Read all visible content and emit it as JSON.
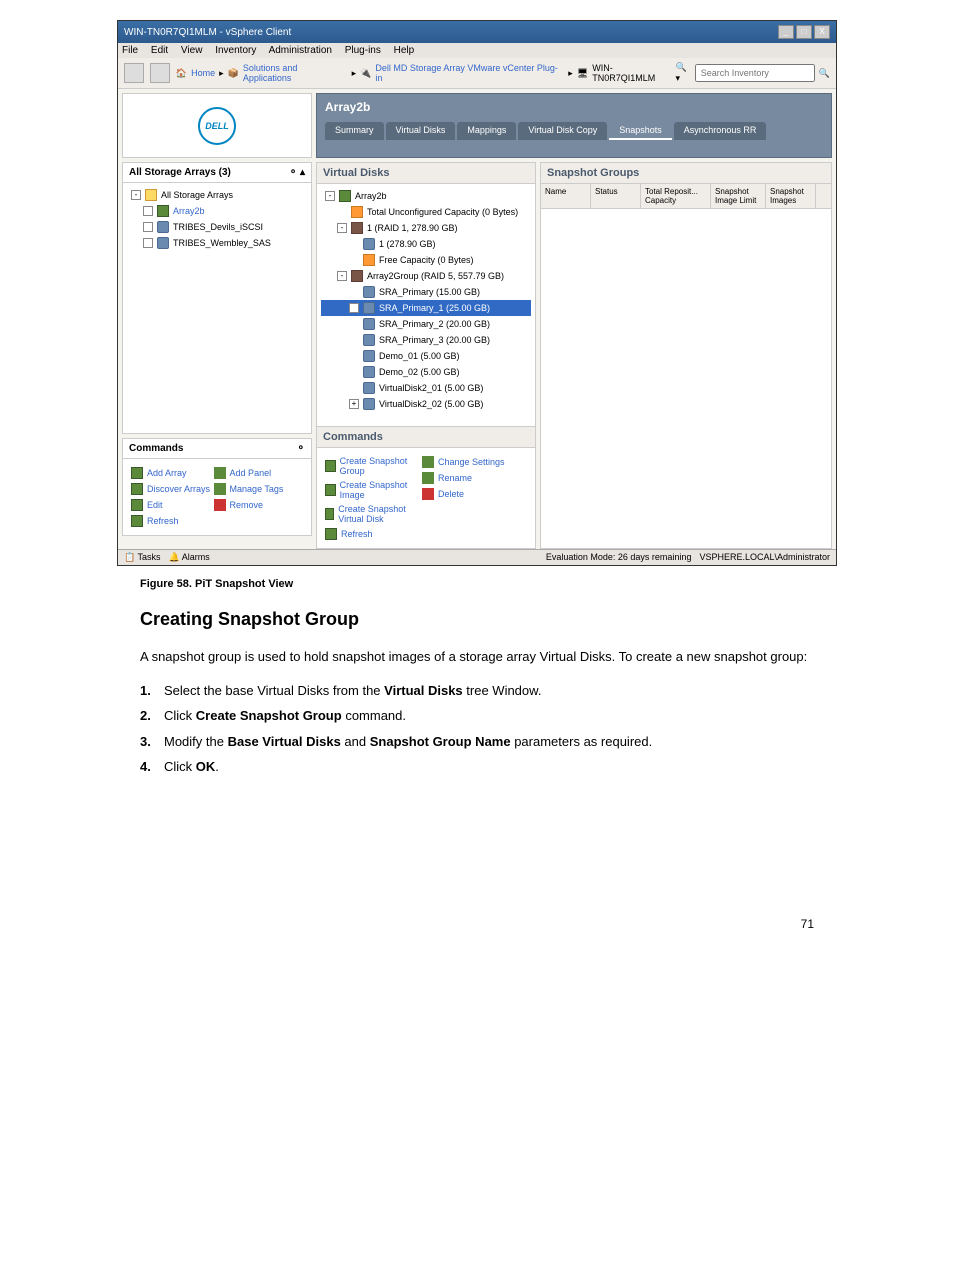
{
  "window": {
    "title": "WIN-TN0R7QI1MLM - vSphere Client",
    "menubar": [
      "File",
      "Edit",
      "View",
      "Inventory",
      "Administration",
      "Plug-ins",
      "Help"
    ]
  },
  "toolbar": {
    "breadcrumb": [
      "Home",
      "Solutions and Applications",
      "Dell MD Storage Array VMware vCenter Plug-in",
      "WIN-TN0R7QI1MLM"
    ],
    "search_placeholder": "Search Inventory"
  },
  "header": {
    "dell": "DELL",
    "title": "Array2b",
    "tabs": [
      "Summary",
      "Virtual Disks",
      "Mappings",
      "Virtual Disk Copy",
      "Snapshots",
      "Asynchronous RR"
    ]
  },
  "left_panel": {
    "title": "All Storage Arrays (3)",
    "tree": [
      {
        "label": "All Storage Arrays",
        "icon": "folder",
        "indent": 0
      },
      {
        "label": "Array2b",
        "icon": "array",
        "indent": 1,
        "link": true
      },
      {
        "label": "TRIBES_Devils_iSCSI",
        "icon": "red",
        "indent": 1
      },
      {
        "label": "TRIBES_Wembley_SAS",
        "icon": "red",
        "indent": 1
      }
    ]
  },
  "vd_panel": {
    "title": "Virtual Disks",
    "tree": [
      {
        "label": "Array2b",
        "icon": "array",
        "indent": 0,
        "exp": "-"
      },
      {
        "label": "Total Unconfigured Capacity (0 Bytes)",
        "icon": "orange",
        "indent": 1
      },
      {
        "label": "1 (RAID 1, 278.90 GB)",
        "icon": "group",
        "indent": 1,
        "exp": "-"
      },
      {
        "label": "1 (278.90 GB)",
        "icon": "disk",
        "indent": 2
      },
      {
        "label": "Free Capacity (0 Bytes)",
        "icon": "orange",
        "indent": 2
      },
      {
        "label": "Array2Group (RAID 5, 557.79 GB)",
        "icon": "group",
        "indent": 1,
        "exp": "-"
      },
      {
        "label": "SRA_Primary (15.00 GB)",
        "icon": "disk",
        "indent": 2
      },
      {
        "label": "SRA_Primary_1 (25.00 GB)",
        "icon": "disk",
        "indent": 2,
        "exp": "+",
        "sel": true
      },
      {
        "label": "SRA_Primary_2 (20.00 GB)",
        "icon": "disk",
        "indent": 2
      },
      {
        "label": "SRA_Primary_3 (20.00 GB)",
        "icon": "disk",
        "indent": 2
      },
      {
        "label": "Demo_01 (5.00 GB)",
        "icon": "disk",
        "indent": 2
      },
      {
        "label": "Demo_02 (5.00 GB)",
        "icon": "disk",
        "indent": 2
      },
      {
        "label": "VirtualDisk2_01 (5.00 GB)",
        "icon": "disk",
        "indent": 2
      },
      {
        "label": "VirtualDisk2_02 (5.00 GB)",
        "icon": "disk",
        "indent": 2,
        "exp": "+"
      }
    ]
  },
  "snap_panel": {
    "title": "Snapshot Groups",
    "cols": [
      "Name",
      "Status",
      "Total Reposit... Capacity",
      "Snapshot Image Limit",
      "Snapshot Images"
    ]
  },
  "left_commands": {
    "title": "Commands",
    "items": [
      [
        "Add Array",
        "Add Panel"
      ],
      [
        "Discover Arrays",
        "Manage Tags"
      ],
      [
        "Edit",
        "Remove"
      ],
      [
        "Refresh",
        ""
      ]
    ]
  },
  "right_commands": {
    "title": "Commands",
    "items": [
      [
        "Create Snapshot Group",
        "Change Settings"
      ],
      [
        "Create Snapshot Image",
        "Rename"
      ],
      [
        "Create Snapshot Virtual Disk",
        "Delete"
      ],
      [
        "Refresh",
        ""
      ]
    ]
  },
  "statusbar": {
    "left": [
      "Tasks",
      "Alarms"
    ],
    "eval": "Evaluation Mode: 26 days remaining",
    "user": "VSPHERE.LOCAL\\Administrator"
  },
  "doc": {
    "figure": "Figure 58. PiT Snapshot View",
    "heading": "Creating Snapshot Group",
    "para": "A snapshot group is used to hold snapshot images of a storage array Virtual Disks. To create a new snapshot group:",
    "steps": [
      {
        "n": "1.",
        "pre": "Select the base Virtual Disks from the ",
        "b": "Virtual Disks",
        "post": " tree Window."
      },
      {
        "n": "2.",
        "pre": "Click ",
        "b": "Create Snapshot Group",
        "post": " command."
      },
      {
        "n": "3.",
        "pre": "Modify the ",
        "b": "Base Virtual Disks",
        "mid": " and ",
        "b2": "Snapshot Group Name",
        "post": " parameters as required."
      },
      {
        "n": "4.",
        "pre": "Click ",
        "b": "OK",
        "post": "."
      }
    ],
    "page": "71"
  }
}
